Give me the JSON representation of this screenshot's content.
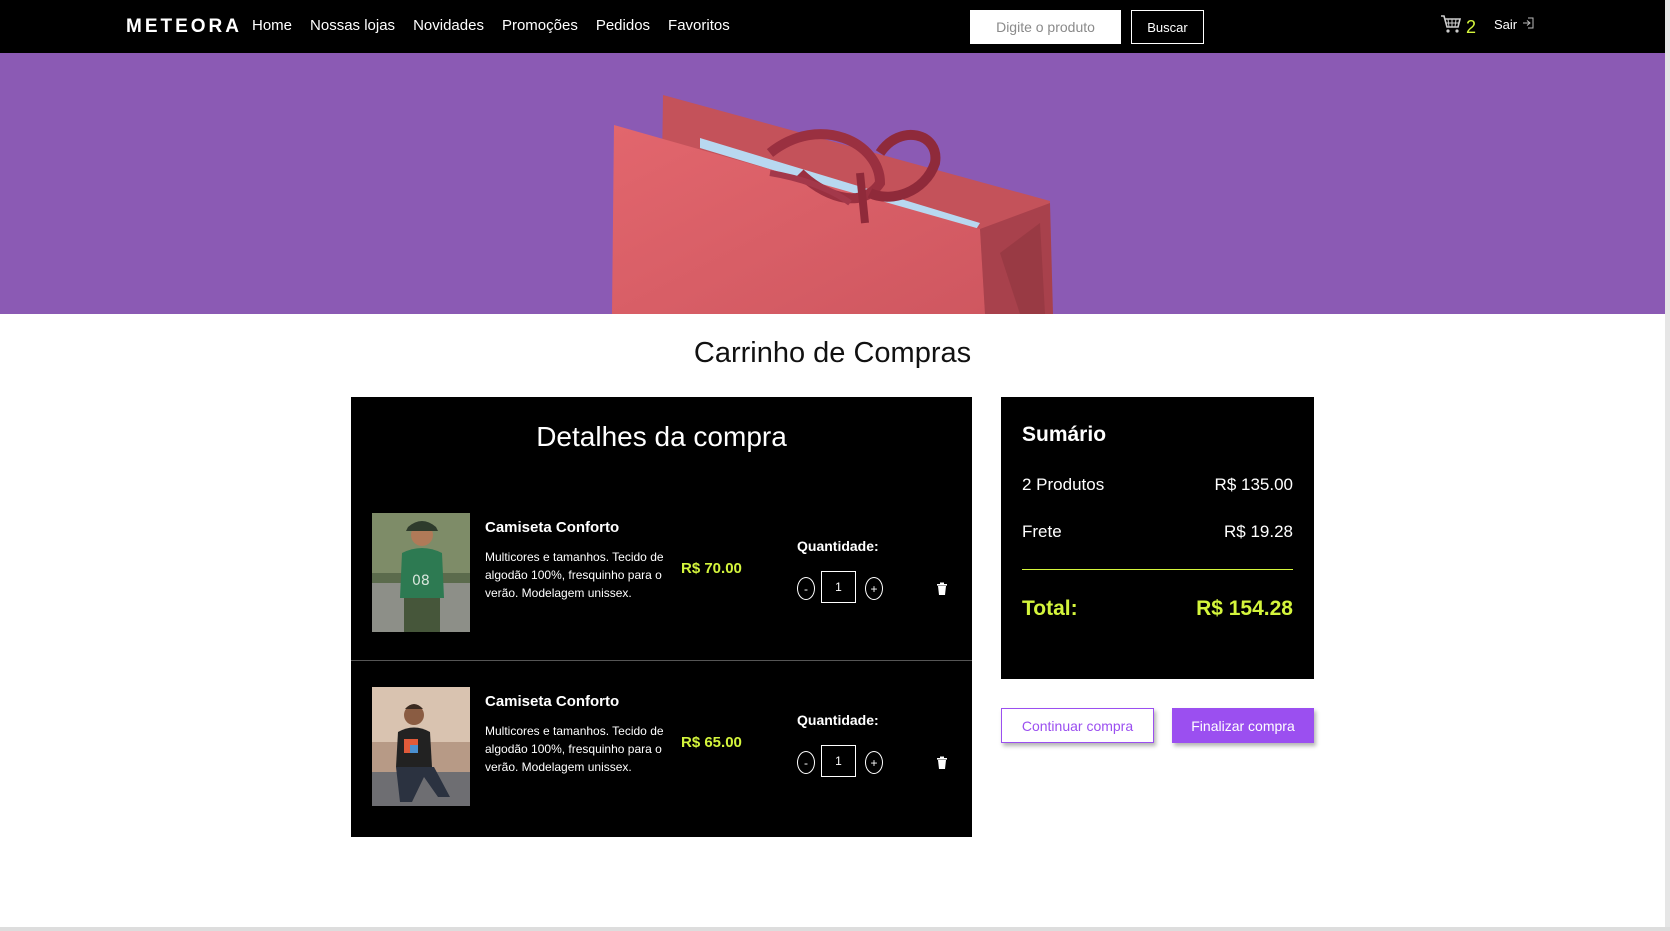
{
  "navbar": {
    "logo": "METEORA",
    "links": [
      "Home",
      "Nossas lojas",
      "Novidades",
      "Promoções",
      "Pedidos",
      "Favoritos"
    ],
    "search_placeholder": "Digite o produto",
    "search_button": "Buscar",
    "cart_count": "2",
    "logout_label": "Sair"
  },
  "hero": {
    "background": "#8b5ab4",
    "bag_color": "#d95f66"
  },
  "page": {
    "title": "Carrinho de Compras"
  },
  "details": {
    "title": "Detalhes da compra",
    "items": [
      {
        "name": "Camiseta Conforto",
        "description": "Multicores e tamanhos. Tecido de algodão 100%, fresquinho para o verão. Modelagem unissex.",
        "price": "R$ 70.00",
        "quantity_label": "Quantidade:",
        "quantity": "1",
        "minus": "-",
        "plus": "+"
      },
      {
        "name": "Camiseta Conforto",
        "description": "Multicores e tamanhos. Tecido de algodão 100%, fresquinho para o verão. Modelagem unissex.",
        "price": "R$ 65.00",
        "quantity_label": "Quantidade:",
        "quantity": "1",
        "minus": "-",
        "plus": "+"
      }
    ]
  },
  "summary": {
    "title": "Sumário",
    "products_label": "2 Produtos",
    "products_value": "R$ 135.00",
    "shipping_label": "Frete",
    "shipping_value": "R$ 19.28",
    "total_label": "Total:",
    "total_value": "R$ 154.28"
  },
  "actions": {
    "continue": "Continuar compra",
    "finish": "Finalizar compra"
  },
  "colors": {
    "accent": "#9b4ff0",
    "highlight": "#d4f53c"
  }
}
